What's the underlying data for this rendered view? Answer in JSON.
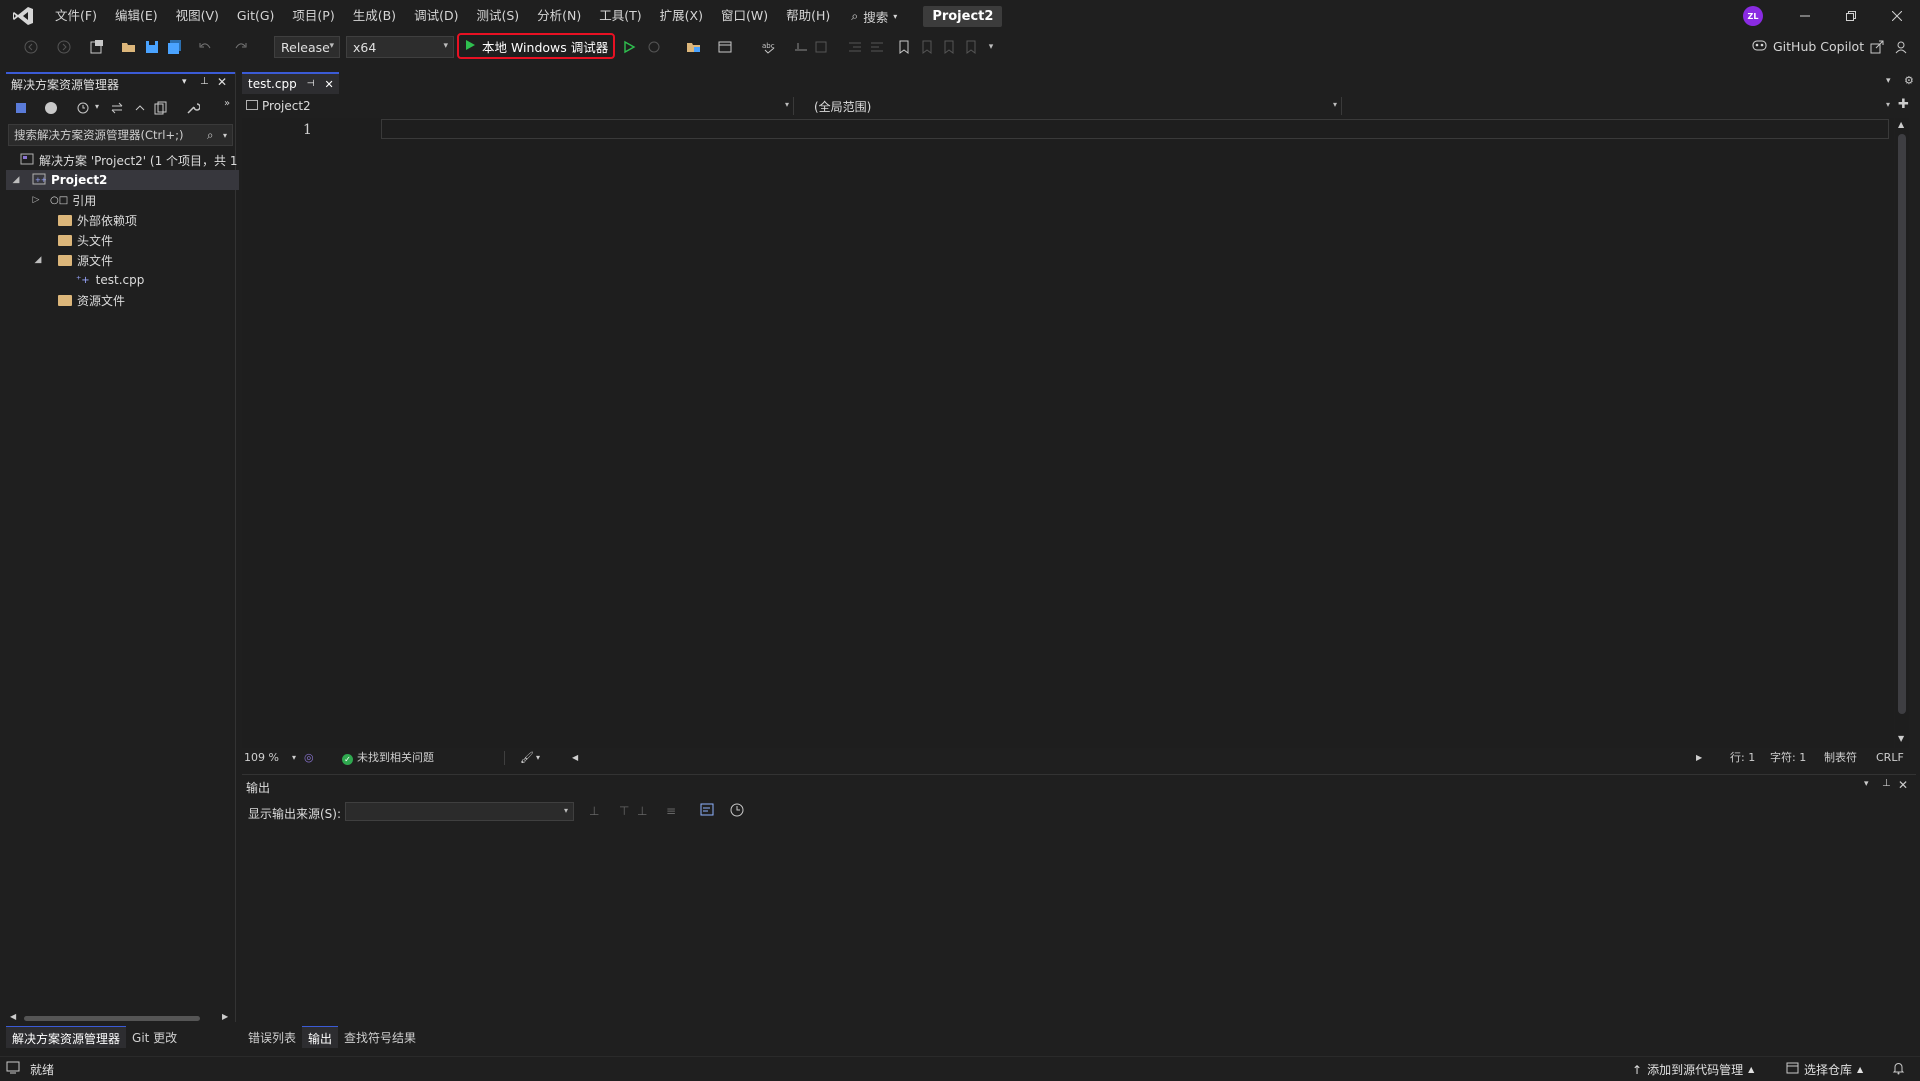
{
  "menu": {
    "items": [
      "文件(F)",
      "编辑(E)",
      "视图(V)",
      "Git(G)",
      "项目(P)",
      "生成(B)",
      "调试(D)",
      "测试(S)",
      "分析(N)",
      "工具(T)",
      "扩展(X)",
      "窗口(W)",
      "帮助(H)"
    ],
    "search_label": "搜索",
    "project_title": "Project2",
    "avatar_initials": "ZL"
  },
  "toolbar": {
    "configuration": "Release",
    "platform": "x64",
    "run_label": "本地 Windows 调试器",
    "copilot_label": "GitHub Copilot"
  },
  "solution_explorer": {
    "title": "解决方案资源管理器",
    "search_placeholder": "搜索解决方案资源管理器(Ctrl+;)",
    "solution_label": "解决方案 'Project2' (1 个项目，共 1",
    "project_label": "Project2",
    "items": [
      {
        "label": "引用"
      },
      {
        "label": "外部依赖项"
      },
      {
        "label": "头文件"
      },
      {
        "label": "源文件"
      },
      {
        "label": "test.cpp"
      },
      {
        "label": "资源文件"
      }
    ]
  },
  "left_bottom_tabs": [
    "解决方案资源管理器",
    "Git 更改"
  ],
  "editor": {
    "tab_name": "test.cpp",
    "nav_project": "Project2",
    "nav_scope": "(全局范围)",
    "line_number": "1",
    "zoom": "109 %",
    "issues": "未找到相关问题",
    "row": "行: 1",
    "col": "字符: 1",
    "indent": "制表符",
    "eol": "CRLF"
  },
  "output": {
    "title": "输出",
    "source_label": "显示输出来源(S):"
  },
  "output_tabs": [
    "错误列表",
    "输出",
    "查找符号结果"
  ],
  "statusbar": {
    "ready": "就绪",
    "add_source_control": "添加到源代码管理",
    "select_repo": "选择仓库"
  },
  "colors": {
    "accent": "#3b5bd6",
    "highlight_border": "#e81123",
    "run_green": "#2fbf4f",
    "background": "#1f1f1f"
  }
}
